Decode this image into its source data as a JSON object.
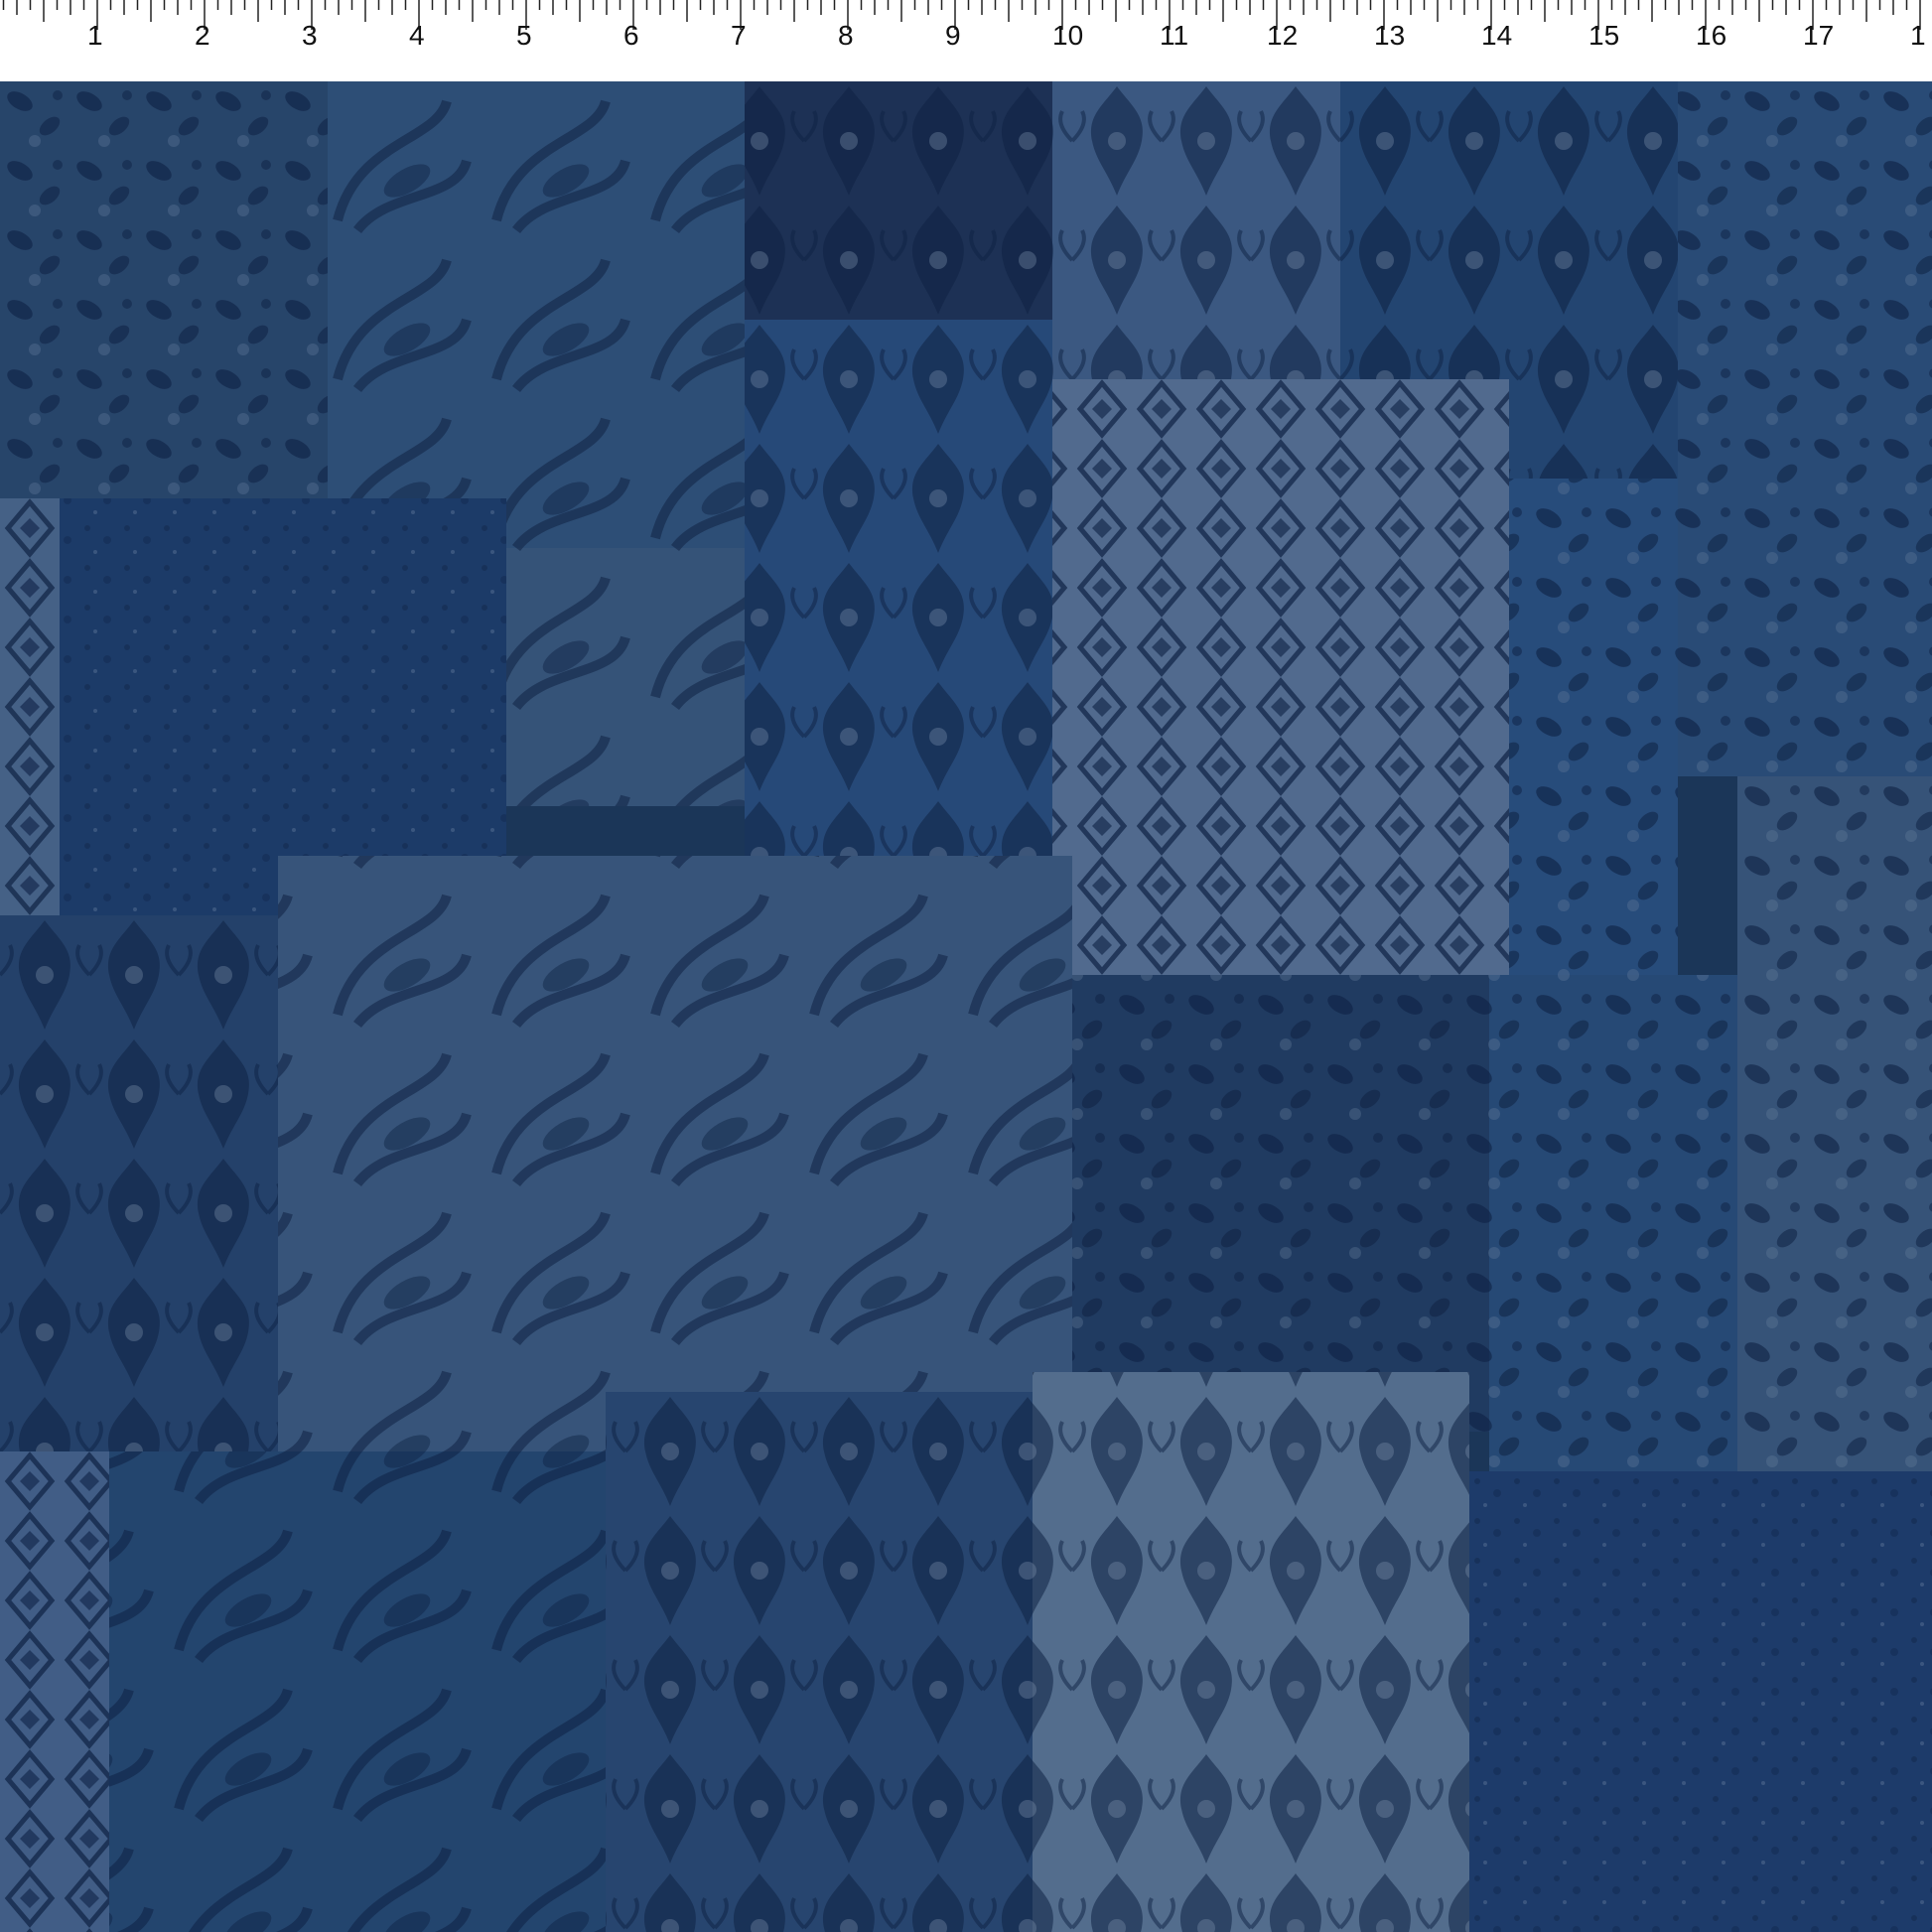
{
  "ruler": {
    "labels": [
      "1",
      "2",
      "3",
      "4",
      "5",
      "6",
      "7",
      "8",
      "9",
      "10",
      "11",
      "12",
      "13",
      "14",
      "15",
      "16",
      "17",
      "1"
    ]
  },
  "fabric": {
    "pattern": "blue damask patchwork",
    "colors": {
      "base": "#1d3a5c",
      "navy": "#0e2244",
      "mid": "#2c4f7a",
      "light": "#6f89a8",
      "pale": "#8fa6c0"
    }
  }
}
